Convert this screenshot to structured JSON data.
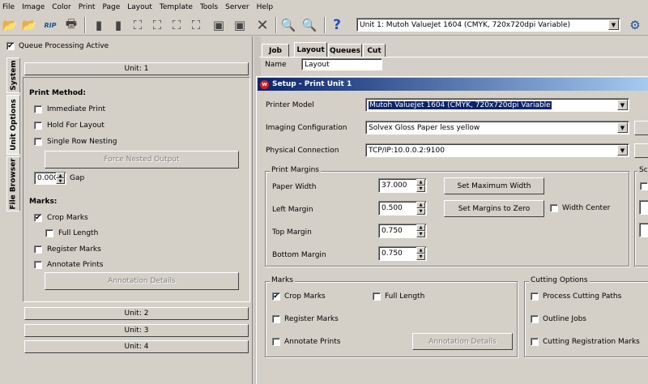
{
  "menu": [
    "File",
    "Image",
    "Color",
    "Print",
    "Page",
    "Layout",
    "Template",
    "Tools",
    "Server",
    "Help"
  ],
  "toolbar": {
    "unit_select": "Unit 1: Mutoh  ValueJet 1604 (CMYK, 720x720dpi Variable)",
    "icons": [
      "open-folder-icon",
      "open-folder-icon",
      "rip-icon",
      "printer-icon",
      "page-icon",
      "page-icon",
      "nest-icon",
      "nest-icon",
      "nest-icon",
      "nest-icon",
      "copy-icon",
      "copy-icon",
      "delete-icon",
      "zoom-in-icon",
      "zoom-out-icon",
      "help-icon",
      "settings-icon"
    ],
    "rip_label": "RIP"
  },
  "left": {
    "queue_active_label": "Queue Processing Active",
    "queue_active_checked": true,
    "side_tabs": [
      "System",
      "Unit Options",
      "File Browser"
    ],
    "unit1_label": "Unit: 1",
    "print_method_heading": "Print Method:",
    "immediate_print": "Immediate Print",
    "hold_for_layout": "Hold For Layout",
    "single_row_nesting": "Single Row Nesting",
    "force_nested_output": "Force Nested Output",
    "gap_value": "0.000",
    "gap_label": "Gap",
    "marks_heading": "Marks:",
    "crop_marks": "Crop Marks",
    "full_length": "Full Length",
    "register_marks": "Register Marks",
    "annotate_prints": "Annotate Prints",
    "annotation_details": "Annotation Details",
    "unit2_label": "Unit: 2",
    "unit3_label": "Unit: 3",
    "unit4_label": "Unit: 4"
  },
  "right": {
    "tabs": [
      "Job",
      "Layout",
      "Queues",
      "Cut"
    ],
    "name_label": "Name",
    "name_value": "Layout",
    "dialog_title": "Setup - Print Unit 1",
    "printer_model_label": "Printer Model",
    "printer_model_value": "Mutoh  ValueJet 1604 (CMYK, 720x720dpi Variable",
    "imaging_config_label": "Imaging Configuration",
    "imaging_config_value": "Solvex Gloss Paper less yellow",
    "physical_conn_label": "Physical Connection",
    "physical_conn_value": "TCP/IP:10.0.0.2:9100",
    "print_margins_title": "Print Margins",
    "paper_width_label": "Paper Width",
    "paper_width_value": "37.000",
    "left_margin_label": "Left Margin",
    "left_margin_value": "0.500",
    "top_margin_label": "Top Margin",
    "top_margin_value": "0.750",
    "bottom_margin_label": "Bottom Margin",
    "bottom_margin_value": "0.750",
    "set_max_width": "Set Maximum Width",
    "set_margins_zero": "Set Margins to Zero",
    "width_center": "Width Center",
    "sc_title": "Sc",
    "marks_title": "Marks",
    "crop_marks": "Crop Marks",
    "full_length": "Full Length",
    "register_marks": "Register Marks",
    "annotate_prints": "Annotate Prints",
    "annotation_details": "Annotation Details",
    "cutting_options_title": "Cutting Options",
    "process_cutting_paths": "Process Cutting Paths",
    "outline_jobs": "Outline Jobs",
    "cutting_reg_marks": "Cutting Registration Marks"
  }
}
